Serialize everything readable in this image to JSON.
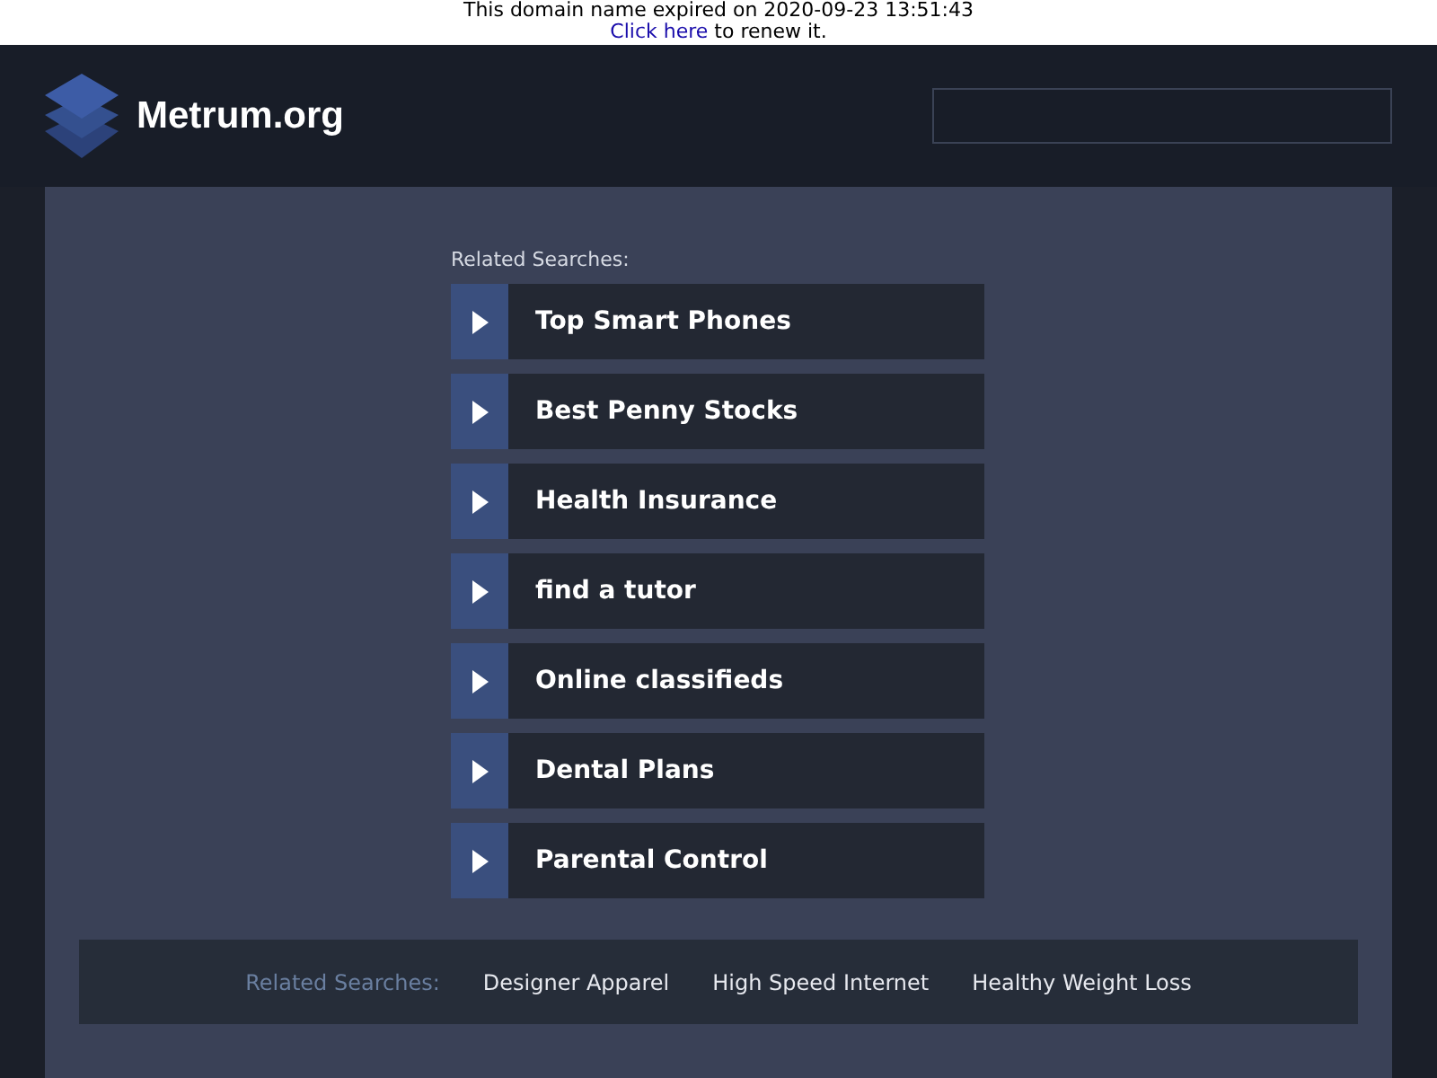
{
  "notice": {
    "text": "This domain name expired on 2020-09-23 13:51:43",
    "link": "Click here",
    "suffix": "to renew it."
  },
  "header": {
    "site_name": "Metrum.org"
  },
  "related": {
    "heading": "Related Searches:",
    "links": [
      {
        "label": "Top Smart Phones"
      },
      {
        "label": "Best Penny Stocks"
      },
      {
        "label": "Health Insurance"
      },
      {
        "label": "find a tutor"
      },
      {
        "label": "Online classifieds"
      },
      {
        "label": "Dental Plans"
      },
      {
        "label": "Parental Control"
      }
    ]
  },
  "footer": {
    "heading": "Related Searches:",
    "links": [
      "Designer Apparel",
      "High Speed Internet",
      "Healthy Weight Loss"
    ]
  }
}
